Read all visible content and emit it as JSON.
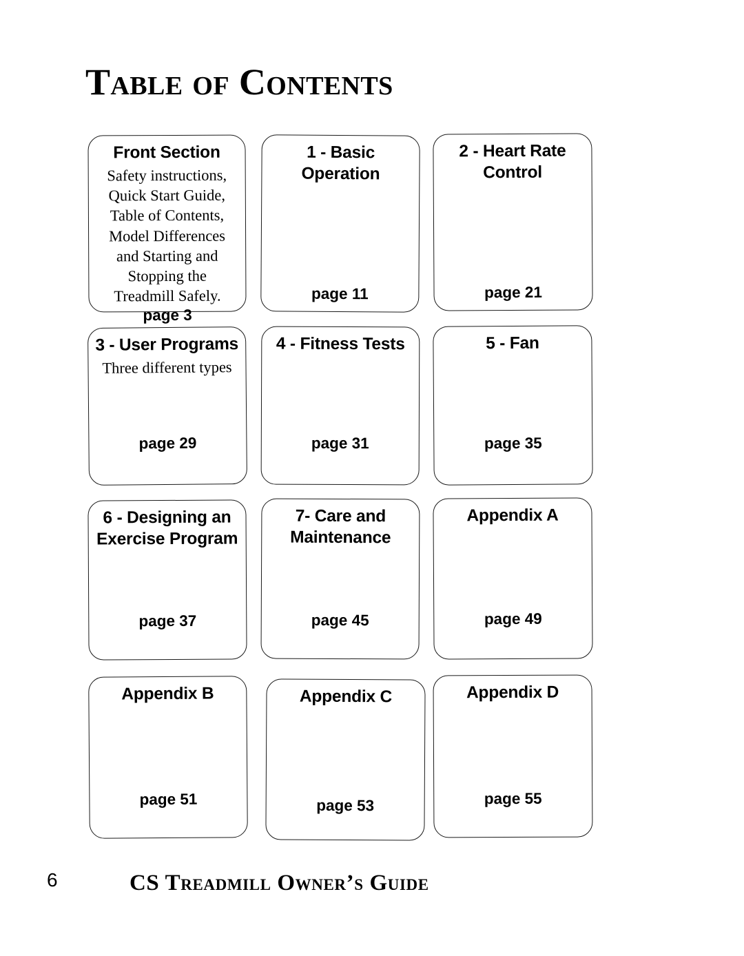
{
  "page": {
    "title": "Table of Contents",
    "footer_page_number": "6",
    "footer_title": "CS Treadmill Owner’s Guide",
    "background_color": "#ffffff",
    "text_color": "#000000",
    "card_border_color": "#1a1a1a"
  },
  "cards": [
    {
      "title": "Front Section",
      "description": "Safety instructions, Quick Start Guide, Table of Contents, Model Differences and Starting and Stopping the Treadmill Safely.",
      "page": "page 3"
    },
    {
      "title": "1 - Basic Operation",
      "description": "",
      "page": "page 11"
    },
    {
      "title": "2 - Heart Rate Control",
      "description": "",
      "page": "page 21"
    },
    {
      "title": "3 - User Programs",
      "description": "Three different types",
      "page": "page 29"
    },
    {
      "title": "4 - Fitness Tests",
      "description": "",
      "page": "page 31"
    },
    {
      "title": "5 - Fan",
      "description": "",
      "page": "page 35"
    },
    {
      "title": "6 - Designing an Exercise Program",
      "description": "",
      "page": "page 37"
    },
    {
      "title": "7- Care and Maintenance",
      "description": "",
      "page": "page 45"
    },
    {
      "title": "Appendix A",
      "description": "",
      "page": "page 49"
    },
    {
      "title": "Appendix B",
      "description": "",
      "page": "page 51"
    },
    {
      "title": "Appendix C",
      "description": "",
      "page": "page 53"
    },
    {
      "title": "Appendix D",
      "description": "",
      "page": "page 55"
    }
  ]
}
